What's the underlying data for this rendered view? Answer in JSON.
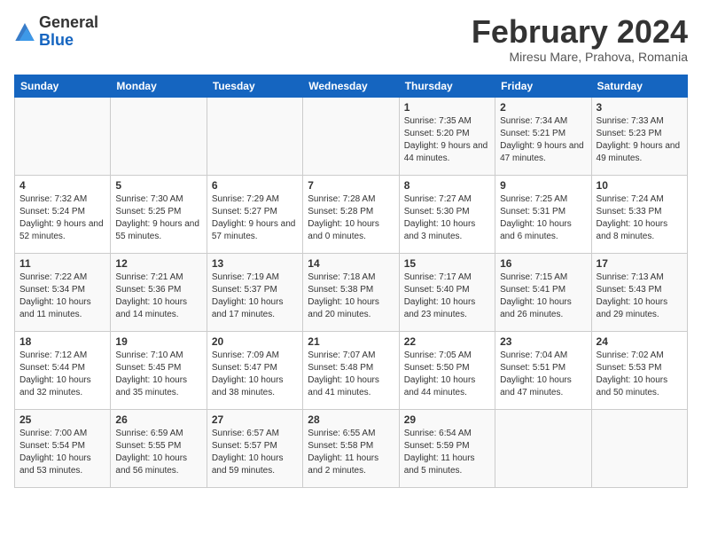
{
  "header": {
    "logo_general": "General",
    "logo_blue": "Blue",
    "month_title": "February 2024",
    "location": "Miresu Mare, Prahova, Romania"
  },
  "weekdays": [
    "Sunday",
    "Monday",
    "Tuesday",
    "Wednesday",
    "Thursday",
    "Friday",
    "Saturday"
  ],
  "weeks": [
    [
      {
        "day": "",
        "info": ""
      },
      {
        "day": "",
        "info": ""
      },
      {
        "day": "",
        "info": ""
      },
      {
        "day": "",
        "info": ""
      },
      {
        "day": "1",
        "info": "Sunrise: 7:35 AM\nSunset: 5:20 PM\nDaylight: 9 hours and 44 minutes."
      },
      {
        "day": "2",
        "info": "Sunrise: 7:34 AM\nSunset: 5:21 PM\nDaylight: 9 hours and 47 minutes."
      },
      {
        "day": "3",
        "info": "Sunrise: 7:33 AM\nSunset: 5:23 PM\nDaylight: 9 hours and 49 minutes."
      }
    ],
    [
      {
        "day": "4",
        "info": "Sunrise: 7:32 AM\nSunset: 5:24 PM\nDaylight: 9 hours and 52 minutes."
      },
      {
        "day": "5",
        "info": "Sunrise: 7:30 AM\nSunset: 5:25 PM\nDaylight: 9 hours and 55 minutes."
      },
      {
        "day": "6",
        "info": "Sunrise: 7:29 AM\nSunset: 5:27 PM\nDaylight: 9 hours and 57 minutes."
      },
      {
        "day": "7",
        "info": "Sunrise: 7:28 AM\nSunset: 5:28 PM\nDaylight: 10 hours and 0 minutes."
      },
      {
        "day": "8",
        "info": "Sunrise: 7:27 AM\nSunset: 5:30 PM\nDaylight: 10 hours and 3 minutes."
      },
      {
        "day": "9",
        "info": "Sunrise: 7:25 AM\nSunset: 5:31 PM\nDaylight: 10 hours and 6 minutes."
      },
      {
        "day": "10",
        "info": "Sunrise: 7:24 AM\nSunset: 5:33 PM\nDaylight: 10 hours and 8 minutes."
      }
    ],
    [
      {
        "day": "11",
        "info": "Sunrise: 7:22 AM\nSunset: 5:34 PM\nDaylight: 10 hours and 11 minutes."
      },
      {
        "day": "12",
        "info": "Sunrise: 7:21 AM\nSunset: 5:36 PM\nDaylight: 10 hours and 14 minutes."
      },
      {
        "day": "13",
        "info": "Sunrise: 7:19 AM\nSunset: 5:37 PM\nDaylight: 10 hours and 17 minutes."
      },
      {
        "day": "14",
        "info": "Sunrise: 7:18 AM\nSunset: 5:38 PM\nDaylight: 10 hours and 20 minutes."
      },
      {
        "day": "15",
        "info": "Sunrise: 7:17 AM\nSunset: 5:40 PM\nDaylight: 10 hours and 23 minutes."
      },
      {
        "day": "16",
        "info": "Sunrise: 7:15 AM\nSunset: 5:41 PM\nDaylight: 10 hours and 26 minutes."
      },
      {
        "day": "17",
        "info": "Sunrise: 7:13 AM\nSunset: 5:43 PM\nDaylight: 10 hours and 29 minutes."
      }
    ],
    [
      {
        "day": "18",
        "info": "Sunrise: 7:12 AM\nSunset: 5:44 PM\nDaylight: 10 hours and 32 minutes."
      },
      {
        "day": "19",
        "info": "Sunrise: 7:10 AM\nSunset: 5:45 PM\nDaylight: 10 hours and 35 minutes."
      },
      {
        "day": "20",
        "info": "Sunrise: 7:09 AM\nSunset: 5:47 PM\nDaylight: 10 hours and 38 minutes."
      },
      {
        "day": "21",
        "info": "Sunrise: 7:07 AM\nSunset: 5:48 PM\nDaylight: 10 hours and 41 minutes."
      },
      {
        "day": "22",
        "info": "Sunrise: 7:05 AM\nSunset: 5:50 PM\nDaylight: 10 hours and 44 minutes."
      },
      {
        "day": "23",
        "info": "Sunrise: 7:04 AM\nSunset: 5:51 PM\nDaylight: 10 hours and 47 minutes."
      },
      {
        "day": "24",
        "info": "Sunrise: 7:02 AM\nSunset: 5:53 PM\nDaylight: 10 hours and 50 minutes."
      }
    ],
    [
      {
        "day": "25",
        "info": "Sunrise: 7:00 AM\nSunset: 5:54 PM\nDaylight: 10 hours and 53 minutes."
      },
      {
        "day": "26",
        "info": "Sunrise: 6:59 AM\nSunset: 5:55 PM\nDaylight: 10 hours and 56 minutes."
      },
      {
        "day": "27",
        "info": "Sunrise: 6:57 AM\nSunset: 5:57 PM\nDaylight: 10 hours and 59 minutes."
      },
      {
        "day": "28",
        "info": "Sunrise: 6:55 AM\nSunset: 5:58 PM\nDaylight: 11 hours and 2 minutes."
      },
      {
        "day": "29",
        "info": "Sunrise: 6:54 AM\nSunset: 5:59 PM\nDaylight: 11 hours and 5 minutes."
      },
      {
        "day": "",
        "info": ""
      },
      {
        "day": "",
        "info": ""
      }
    ]
  ]
}
